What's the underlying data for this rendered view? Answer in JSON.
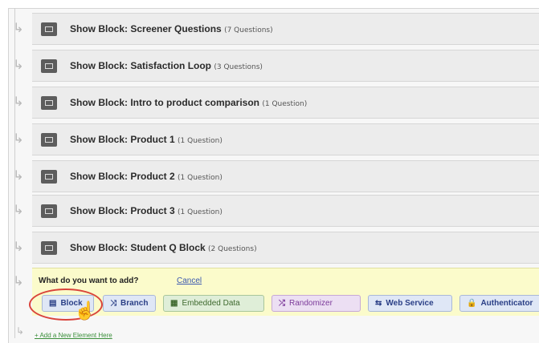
{
  "blocks": [
    {
      "label": "Show Block: Screener Questions",
      "count": "(7 Questions)"
    },
    {
      "label": "Show Block: Satisfaction Loop",
      "count": "(3 Questions)"
    },
    {
      "label": "Show Block: Intro to product comparison",
      "count": "(1 Question)"
    },
    {
      "label": "Show Block: Product 1",
      "count": "(1 Question)"
    },
    {
      "label": "Show Block: Product 2",
      "count": "(1 Question)"
    },
    {
      "label": "Show Block: Product 3",
      "count": "(1 Question)"
    },
    {
      "label": "Show Block: Student Q Block",
      "count": "(2 Questions)"
    }
  ],
  "add_panel": {
    "prompt": "What do you want to add?",
    "cancel": "Cancel",
    "buttons": {
      "block": "Block",
      "branch": "Branch",
      "embedded_data": "Embedded Data",
      "randomizer": "Randomizer",
      "web_service": "Web Service",
      "authenticator": "Authenticator"
    }
  },
  "add_new_element": "+ Add a New Element Here",
  "icons": {
    "block": "block-icon",
    "branch": "branch-icon",
    "embedded_data": "embedded-data-icon",
    "randomizer": "shuffle-icon",
    "web_service": "web-service-icon",
    "authenticator": "lock-icon",
    "cursor": "hand-pointer-icon"
  },
  "colors": {
    "panel_background": "#fbfbcb",
    "highlight_ring": "#d9433b",
    "link": "#3b58b0",
    "add_new_link": "#3b8f3b"
  }
}
